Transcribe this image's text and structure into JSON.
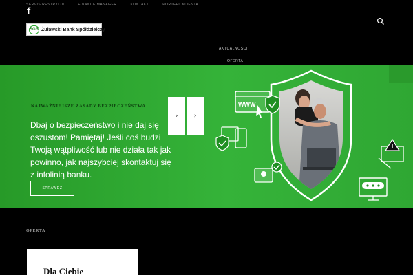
{
  "topnav": {
    "items": [
      "SERVIS RESTRYCJI",
      "FINANCE MANAGER",
      "KONTAKT",
      "PORTFEL KLIENTA"
    ]
  },
  "social": {
    "facebook_glyph": "f",
    "icon": "facebook-icon"
  },
  "search": {
    "icon": "search-icon"
  },
  "logo": {
    "badge": "SGB",
    "name": "Żuławski Bank Spółdzielczy",
    "brand_color": "#27a52a"
  },
  "menu_dropdown": {
    "item1": "AKTUALNOŚCI",
    "item2": "OFERTA"
  },
  "hero": {
    "title": "NAJWAŻNIEJSZE ZASADY BEZPIECZEŃSTWA",
    "text": "Dbaj o bezpieczeństwo i nie daj się oszustom! Pamiętaj! Jeśli coś budzi Twoją wątpliwość lub nie działa tak jak powinno, jak najszybciej skontaktuj się z infolinią banku.",
    "button": "SPRAWDŹ",
    "prev": "‹",
    "next": "›",
    "bg_color": "#2fa733",
    "www": "WWW"
  },
  "offer": {
    "heading": "OFERTA",
    "card_title": "Dla Ciebie"
  }
}
